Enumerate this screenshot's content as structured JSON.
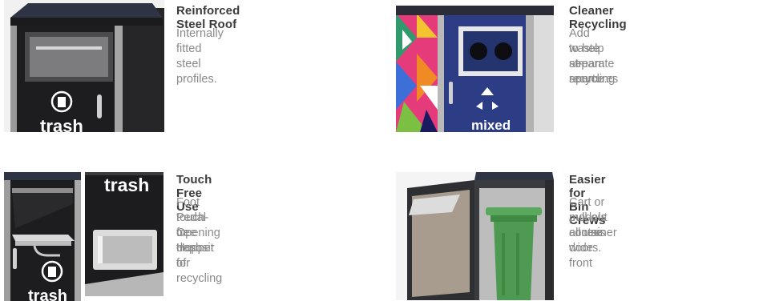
{
  "features": [
    {
      "title": "Reinforced Steel Roof",
      "description": "Internally fitted steel profiles.",
      "image_label": "trash"
    },
    {
      "title": "Cleaner Recycling",
      "description_lines": [
        "Add waste stream apertures",
        "to help separate recycling",
        "at-source."
      ],
      "image_label": "mixed"
    },
    {
      "title": "Touch Free Use",
      "description_lines": [
        "Foot Pedal Opening Hopper for",
        "touch-free deposit of recycling",
        "or trash."
      ],
      "image_labels": [
        "trash",
        "trash"
      ]
    },
    {
      "title": "Easier for Bin Crews",
      "description_lines": [
        "Cart or pull-out container",
        "models all use wide front",
        "access doors."
      ]
    }
  ],
  "colors": {
    "title": "#3b3b3b",
    "description": "#8a8a8a",
    "bin_dark": "#1f1f21",
    "bin_blue": "#2c3d86",
    "cart_green": "#4f9a52"
  }
}
